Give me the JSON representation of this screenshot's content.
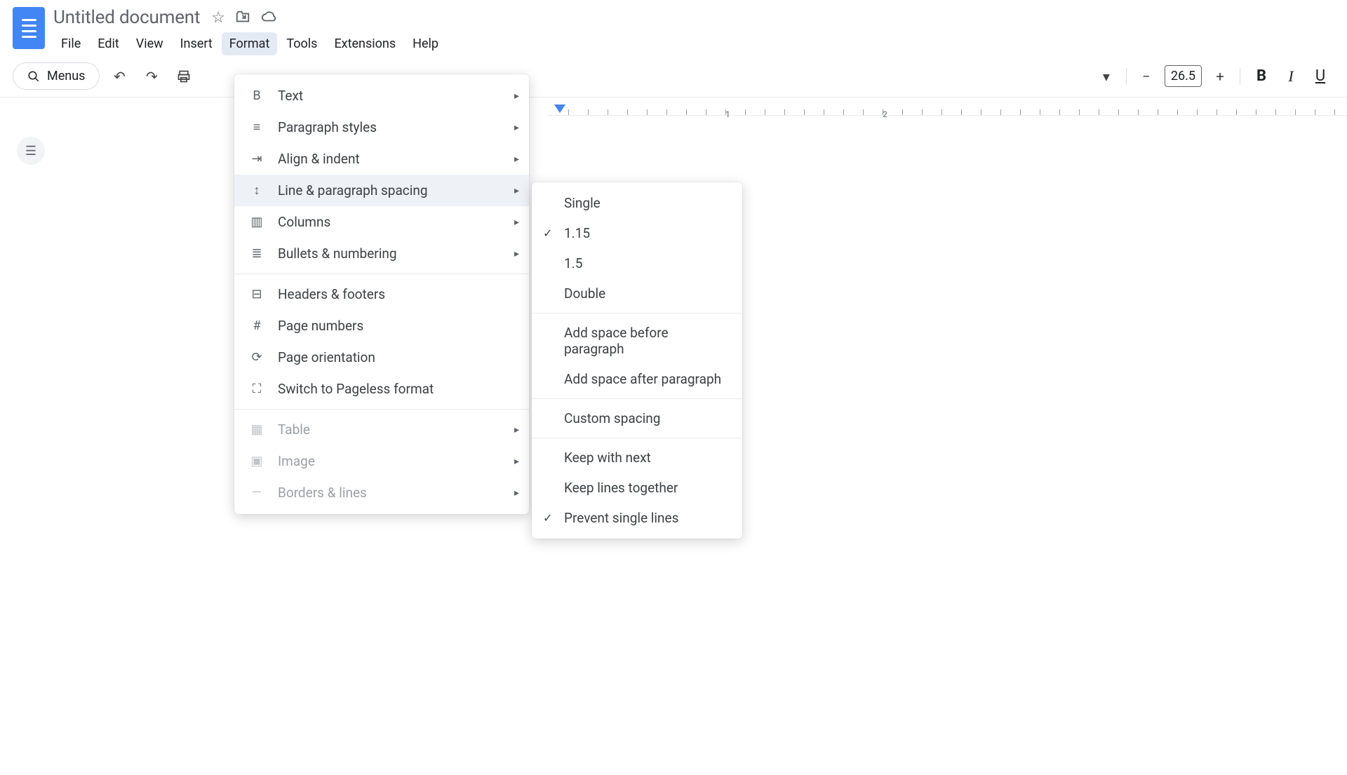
{
  "header": {
    "title": "Untitled document",
    "menus": [
      "File",
      "Edit",
      "View",
      "Insert",
      "Format",
      "Tools",
      "Extensions",
      "Help"
    ],
    "active_menu_index": 4
  },
  "toolbar": {
    "search_label": "Menus",
    "zoom_value": "26.5"
  },
  "ruler": {
    "marks": [
      "1",
      "2"
    ]
  },
  "format_menu": {
    "groups": [
      [
        {
          "icon": "bold-icon",
          "glyph": "B",
          "label": "Text",
          "arrow": true
        },
        {
          "icon": "paragraph-styles-icon",
          "glyph": "≡",
          "label": "Paragraph styles",
          "arrow": true
        },
        {
          "icon": "align-indent-icon",
          "glyph": "⇥",
          "label": "Align & indent",
          "arrow": true
        },
        {
          "icon": "line-spacing-icon",
          "glyph": "↕",
          "label": "Line & paragraph spacing",
          "arrow": true,
          "hover": true
        },
        {
          "icon": "columns-icon",
          "glyph": "▥",
          "label": "Columns",
          "arrow": true
        },
        {
          "icon": "bullets-numbering-icon",
          "glyph": "≣",
          "label": "Bullets & numbering",
          "arrow": true
        }
      ],
      [
        {
          "icon": "headers-footers-icon",
          "glyph": "⊟",
          "label": "Headers & footers"
        },
        {
          "icon": "page-numbers-icon",
          "glyph": "#",
          "label": "Page numbers"
        },
        {
          "icon": "page-orientation-icon",
          "glyph": "⟳",
          "label": "Page orientation"
        },
        {
          "icon": "pageless-icon",
          "glyph": "⛶",
          "label": "Switch to Pageless format"
        }
      ],
      [
        {
          "icon": "table-icon",
          "glyph": "▦",
          "label": "Table",
          "arrow": true,
          "disabled": true
        },
        {
          "icon": "image-icon",
          "glyph": "▣",
          "label": "Image",
          "arrow": true,
          "disabled": true
        },
        {
          "icon": "borders-lines-icon",
          "glyph": "—",
          "label": "Borders & lines",
          "arrow": true,
          "disabled": true
        }
      ]
    ]
  },
  "spacing_menu": {
    "groups": [
      [
        {
          "label": "Single"
        },
        {
          "label": "1.15",
          "checked": true
        },
        {
          "label": "1.5"
        },
        {
          "label": "Double"
        }
      ],
      [
        {
          "label": "Add space before paragraph"
        },
        {
          "label": "Add space after paragraph"
        }
      ],
      [
        {
          "label": "Custom spacing"
        }
      ],
      [
        {
          "label": "Keep with next"
        },
        {
          "label": "Keep lines together"
        },
        {
          "label": "Prevent single lines",
          "checked": true
        }
      ]
    ]
  }
}
